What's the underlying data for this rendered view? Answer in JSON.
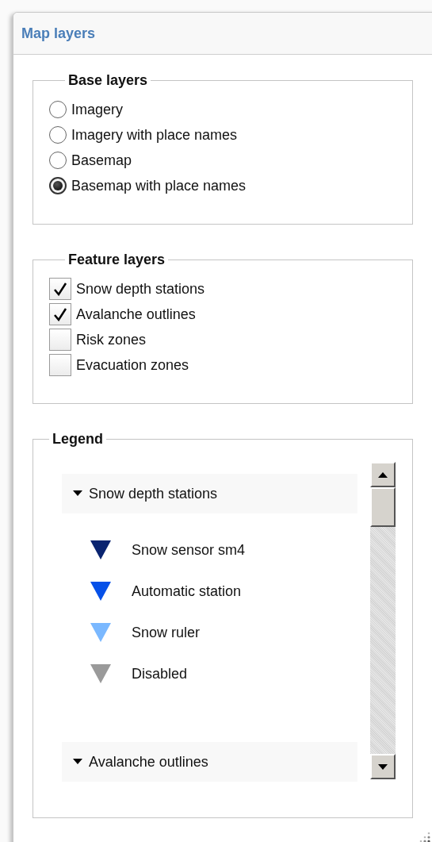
{
  "panel": {
    "title": "Map layers"
  },
  "base_layers": {
    "title": "Base layers",
    "options": [
      {
        "label": "Imagery",
        "selected": false
      },
      {
        "label": "Imagery with place names",
        "selected": false
      },
      {
        "label": "Basemap",
        "selected": false
      },
      {
        "label": "Basemap with place names",
        "selected": true
      }
    ]
  },
  "feature_layers": {
    "title": "Feature layers",
    "options": [
      {
        "label": "Snow depth stations",
        "checked": true
      },
      {
        "label": "Avalanche outlines",
        "checked": true
      },
      {
        "label": "Risk zones",
        "checked": false
      },
      {
        "label": "Evacuation zones",
        "checked": false
      }
    ]
  },
  "legend": {
    "title": "Legend",
    "groups": [
      {
        "label": "Snow depth stations",
        "expanded": true,
        "items": [
          {
            "label": "Snow sensor sm4",
            "color": "#0a2470"
          },
          {
            "label": "Automatic station",
            "color": "#0650e8"
          },
          {
            "label": "Snow ruler",
            "color": "#7ab8ff"
          },
          {
            "label": "Disabled",
            "color": "#9a9a9a"
          }
        ]
      },
      {
        "label": "Avalanche outlines",
        "expanded": true
      }
    ]
  }
}
